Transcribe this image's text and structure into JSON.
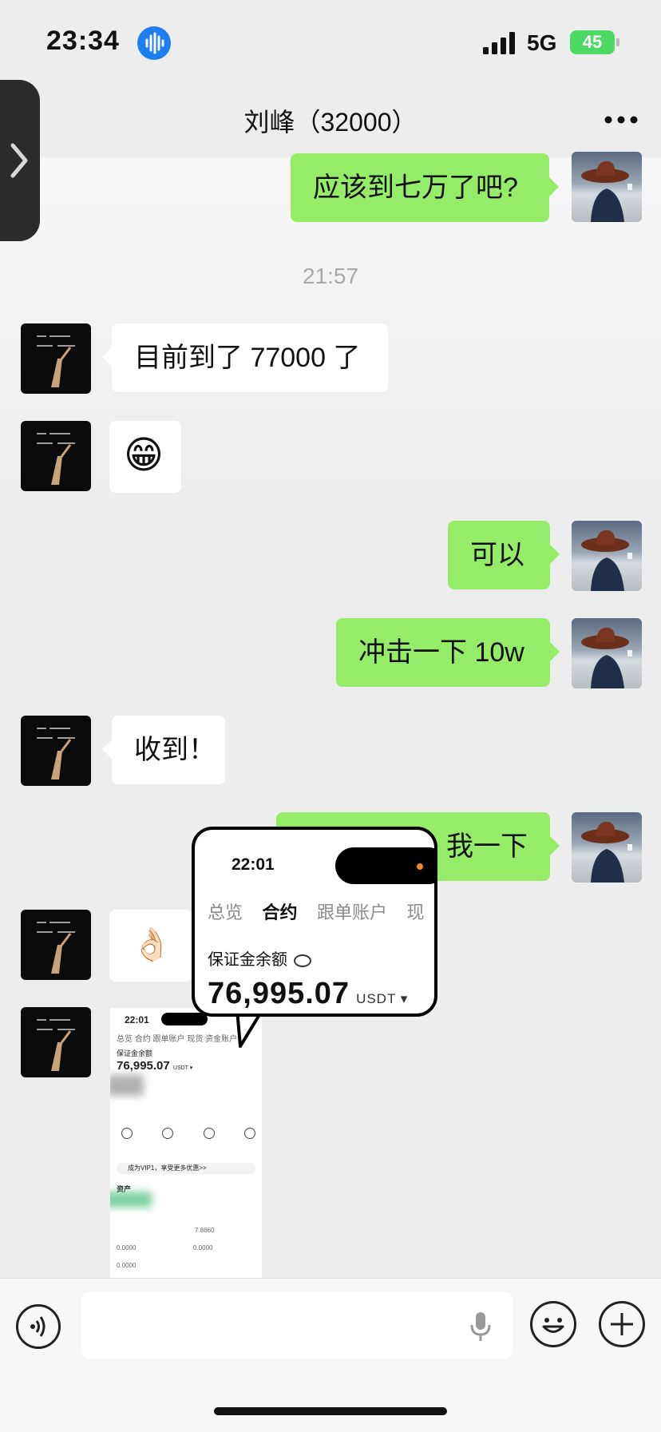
{
  "status_bar": {
    "time": "23:34",
    "network": "5G",
    "battery": "45"
  },
  "nav": {
    "title": "刘峰（32000）"
  },
  "timestamp": "21:57",
  "messages": {
    "m1": "应该到七万了吧?",
    "m2": "目前到了 77000 了",
    "m3_emoji": "😁",
    "m4": "可以",
    "m5": "冲击一下 10w",
    "m6": "收到！",
    "m7": "我一下",
    "m8_emoji": "👌🏻"
  },
  "screenshot_message": {
    "time": "22:01",
    "tabs": "总览  合约  跟单账户  现货  资金账户",
    "margin_label": "保证金余额",
    "amount": "76,995.07",
    "unit": "USDT ▾",
    "banner": "成为VIP1，享受更多优惠>>",
    "assets_label": "资产",
    "small_values": [
      "0.0000",
      "0.0000",
      "0.0000",
      "7.8660"
    ]
  },
  "callout": {
    "time": "22:01",
    "tabs": [
      "总览",
      "合约",
      "跟单账户",
      "现"
    ],
    "margin_label": "保证金余额",
    "amount": "76,995.07",
    "unit": "USDT ▾"
  },
  "colors": {
    "green_bubble": "#95ec69",
    "background": "#ededed"
  }
}
